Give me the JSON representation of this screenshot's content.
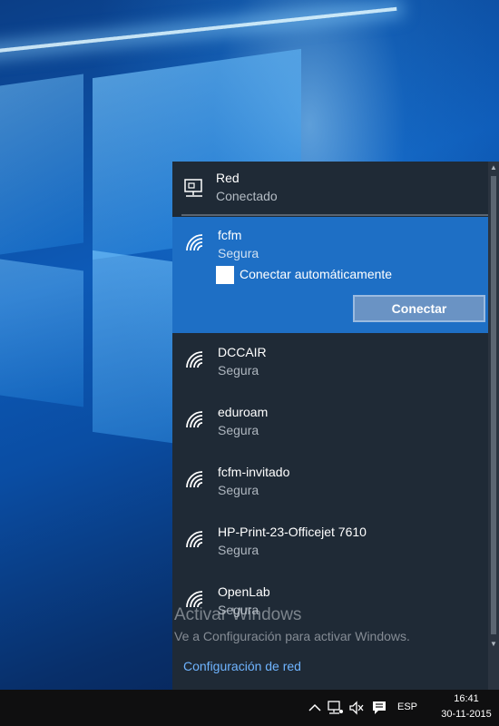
{
  "flyout": {
    "wired": {
      "name": "Red",
      "status": "Conectado",
      "icon": "ethernet-icon"
    },
    "selected": {
      "name": "fcfm",
      "security": "Segura",
      "auto_connect_label": "Conectar automáticamente",
      "connect_label": "Conectar",
      "icon": "wifi-icon"
    },
    "networks": [
      {
        "name": "DCCAIR",
        "security": "Segura",
        "icon": "wifi-icon"
      },
      {
        "name": "eduroam",
        "security": "Segura",
        "icon": "wifi-icon"
      },
      {
        "name": "fcfm-invitado",
        "security": "Segura",
        "icon": "wifi-icon"
      },
      {
        "name": "HP-Print-23-Officejet 7610",
        "security": "Segura",
        "icon": "wifi-icon"
      },
      {
        "name": "OpenLab",
        "security": "Segura",
        "icon": "wifi-icon"
      }
    ],
    "watermark_title": "Activar Windows",
    "watermark_text": "Ve a Configuración para activar Windows.",
    "settings_link": "Configuración de red"
  },
  "taskbar": {
    "language": "ESP",
    "time": "16:41",
    "date": "30-11-2015",
    "tray_icons": [
      "chevron-up-icon",
      "network-icon",
      "volume-muted-icon",
      "action-center-icon"
    ]
  },
  "colors": {
    "flyout_bg": "#1f2a36",
    "selected_bg": "#1e6fc5",
    "link": "#6fb4ff",
    "taskbar_bg": "#0f0f10"
  }
}
